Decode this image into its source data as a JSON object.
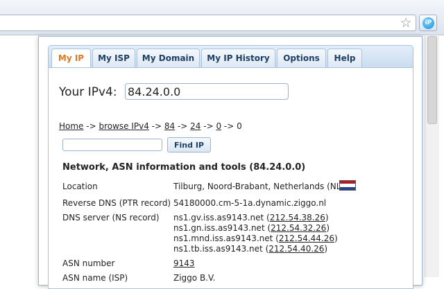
{
  "browser": {
    "star_glyph": "☆",
    "extension_icon_text": "iP"
  },
  "tabs": [
    {
      "label": "My IP",
      "active": true
    },
    {
      "label": "My ISP",
      "active": false
    },
    {
      "label": "My Domain",
      "active": false
    },
    {
      "label": "My IP History",
      "active": false
    },
    {
      "label": "Options",
      "active": false
    },
    {
      "label": "Help",
      "active": false
    }
  ],
  "ipv4": {
    "label": "Your IPv4:",
    "value": "84.24.0.0"
  },
  "breadcrumb": {
    "home": "Home",
    "sep1": " -> ",
    "browse": "browse IPv4",
    "sep2": " -> ",
    "octet1": "84",
    "sep3": " -> ",
    "octet2": "24",
    "sep4": " -> ",
    "octet3": "0",
    "sep5": " -> ",
    "octet4": "0"
  },
  "find": {
    "input_value": "",
    "button_label": "Find IP"
  },
  "network": {
    "title": "Network, ASN information and tools (84.24.0.0)",
    "location_label": "Location",
    "location_value": "Tilburg, Noord-Brabant, Netherlands (NL)",
    "flag_colors": [
      "#ae1c28",
      "#ffffff",
      "#21468b"
    ],
    "rdns_label": "Reverse DNS (PTR record)",
    "rdns_value": "54180000.cm-5-1a.dynamic.ziggo.nl",
    "dns_label": "DNS server (NS record)",
    "dns_servers": [
      {
        "host": "ns1.gv.iss.as9143.net",
        "ip": "212.54.38.26"
      },
      {
        "host": "ns1.gn.iss.as9143.net",
        "ip": "212.54.32.26"
      },
      {
        "host": "ns1.mnd.iss.as9143.net",
        "ip": "212.54.44.26"
      },
      {
        "host": "ns1.tb.iss.as9143.net",
        "ip": "212.54.40.26"
      }
    ],
    "asn_label": "ASN number",
    "asn_value": "9143",
    "asn_name_label": "ASN name (ISP)",
    "asn_name_value": "Ziggo B.V."
  }
}
